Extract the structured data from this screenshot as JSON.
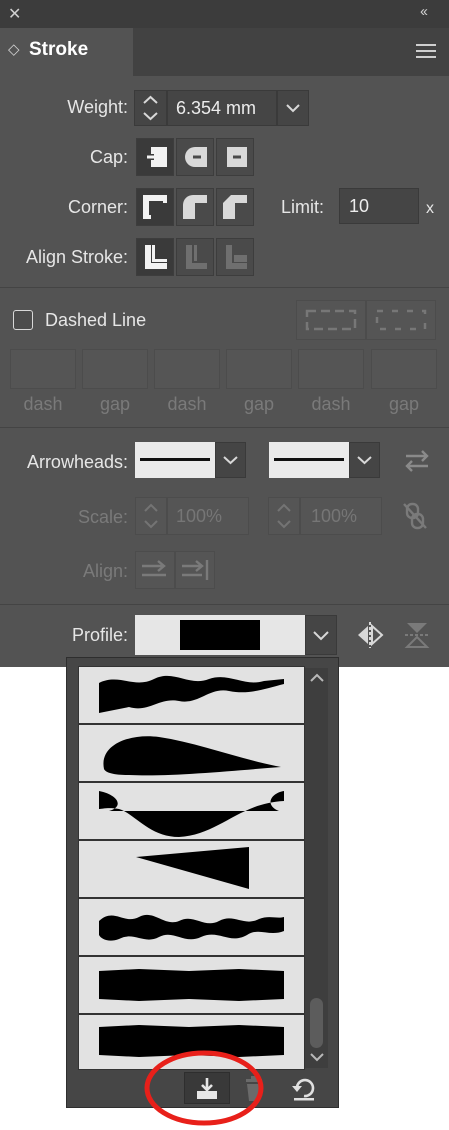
{
  "window": {
    "close_glyph": "✕",
    "collapse_glyph": "‹‹"
  },
  "tab": {
    "title": "Stroke",
    "toggle_glyph": "◇"
  },
  "weight": {
    "label": "Weight:",
    "value": "6.354 mm"
  },
  "cap": {
    "label": "Cap:"
  },
  "corner": {
    "label": "Corner:",
    "limit_label": "Limit:",
    "limit_value": "10",
    "limit_unit": "x"
  },
  "align_stroke": {
    "label": "Align Stroke:"
  },
  "dashed": {
    "label": "Dashed Line",
    "checked": false,
    "cell_labels": [
      "dash",
      "gap",
      "dash",
      "gap",
      "dash",
      "gap"
    ]
  },
  "arrowheads": {
    "label": "Arrowheads:"
  },
  "scale": {
    "label": "Scale:",
    "start_value": "100%",
    "end_value": "100%"
  },
  "align_arrow": {
    "label": "Align:"
  },
  "profile": {
    "label": "Profile:"
  },
  "profile_options": [
    "wavy-taper",
    "teardrop",
    "bulge",
    "triangle",
    "wave",
    "uniform-ragged",
    "uniform-ragged"
  ],
  "colors": {
    "panel": "#535353",
    "highlight_circle": "#e8201a"
  }
}
